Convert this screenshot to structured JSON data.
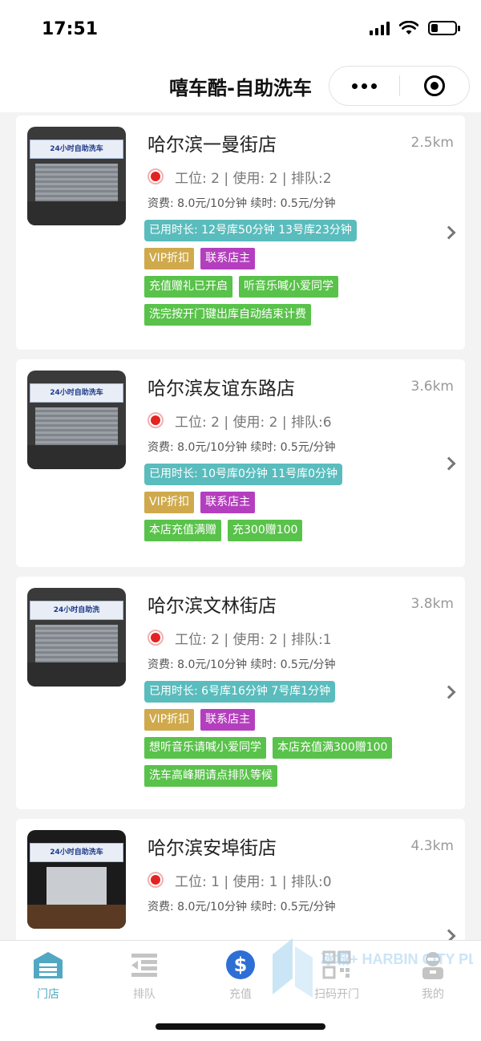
{
  "status_bar": {
    "time": "17:51"
  },
  "nav": {
    "title": "嘻车酷-自助洗车"
  },
  "stores": [
    {
      "name": "哈尔滨一曼街店",
      "distance": "2.5km",
      "status": "工位: 2 | 使用: 2 | 排队:2",
      "fee": "资费: 8.0元/10分钟  续时: 0.5元/分钟",
      "usage": "已用时长: 12号库50分钟 13号库23分钟",
      "vip": "VIP折扣",
      "contact": "联系店主",
      "promos": [
        "充值赠礼已开启",
        "听音乐喊小爱同学",
        "洗完按开门键出库自动结束计费"
      ],
      "sign": "24小时自助洗车"
    },
    {
      "name": "哈尔滨友谊东路店",
      "distance": "3.6km",
      "status": "工位: 2 | 使用: 2 | 排队:6",
      "fee": "资费: 8.0元/10分钟  续时: 0.5元/分钟",
      "usage": "已用时长: 10号库0分钟 11号库0分钟",
      "vip": "VIP折扣",
      "contact": "联系店主",
      "promos": [
        "本店充值满赠",
        "充300赠100"
      ],
      "sign": "24小时自助洗车"
    },
    {
      "name": "哈尔滨文林街店",
      "distance": "3.8km",
      "status": "工位: 2 | 使用: 2 | 排队:1",
      "fee": "资费: 8.0元/10分钟  续时: 0.5元/分钟",
      "usage": "已用时长: 6号库16分钟 7号库1分钟",
      "vip": "VIP折扣",
      "contact": "联系店主",
      "promos": [
        "想听音乐请喊小爱同学",
        "本店充值满300赠100",
        "洗车高峰期请点排队等候"
      ],
      "sign": "24小时自助洗"
    },
    {
      "name": "哈尔滨安埠街店",
      "distance": "4.3km",
      "status": "工位: 1 | 使用: 1 | 排队:0",
      "fee": "资费: 8.0元/10分钟  续时: 0.5元/分钟",
      "sign": "24小时自助洗车"
    }
  ],
  "tabbar": {
    "tabs": [
      {
        "label": "门店",
        "icon": "garage-icon",
        "active": true
      },
      {
        "label": "排队",
        "icon": "queue-icon",
        "active": false
      },
      {
        "label": "充值",
        "icon": "dollar-icon",
        "active": false
      },
      {
        "label": "扫码开门",
        "icon": "qr-code-icon",
        "active": false
      },
      {
        "label": "我的",
        "icon": "robot-user-icon",
        "active": false
      }
    ]
  },
  "watermark": "冰城+ HARBIN CITY PLUS",
  "colors": {
    "accent": "#52a8c2",
    "teal_tag": "#5abcbd",
    "vip_tag": "#cfa94b",
    "contact_tag": "#b43fbe",
    "promo_tag": "#59c24a",
    "status_red": "#e52222"
  }
}
